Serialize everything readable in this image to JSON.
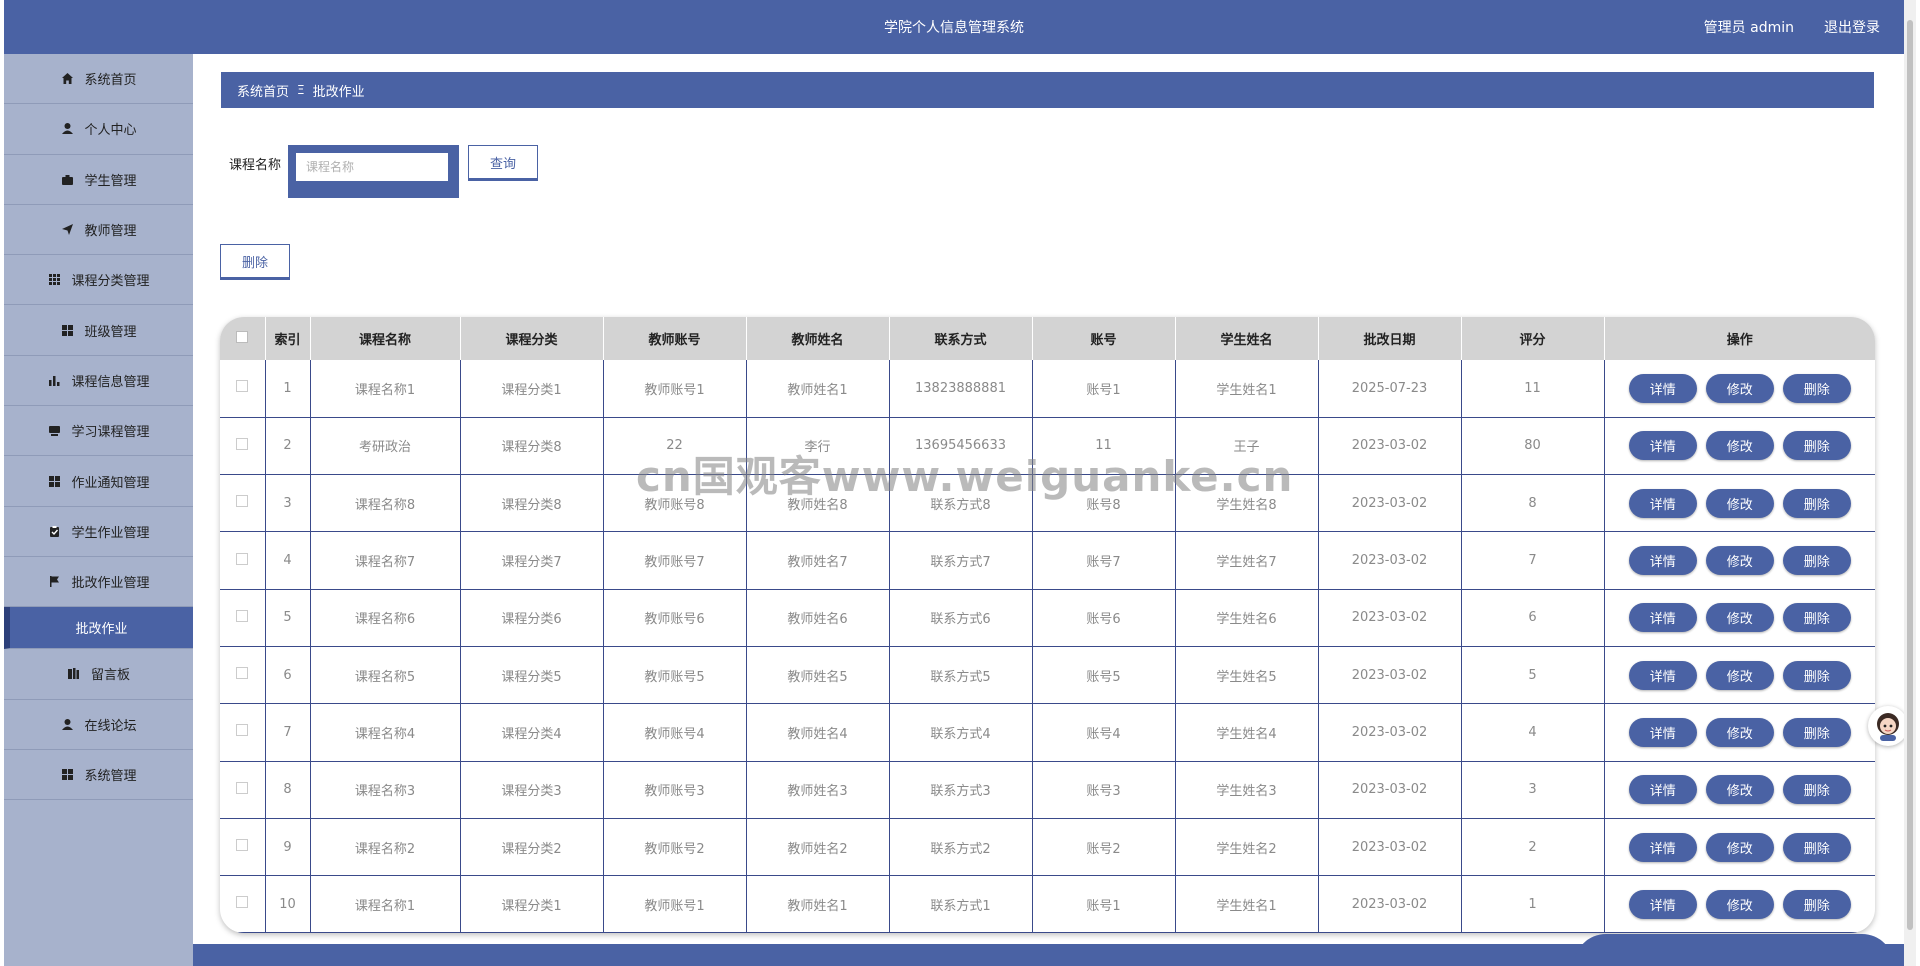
{
  "header": {
    "title": "学院个人信息管理系统",
    "admin": "管理员 admin",
    "logout": "退出登录"
  },
  "sidebar": {
    "items": [
      {
        "label": "系统首页",
        "icon": "home-icon"
      },
      {
        "label": "个人中心",
        "icon": "user-icon"
      },
      {
        "label": "学生管理",
        "icon": "briefcase-icon"
      },
      {
        "label": "教师管理",
        "icon": "paper-plane-icon"
      },
      {
        "label": "课程分类管理",
        "icon": "grid-icon"
      },
      {
        "label": "班级管理",
        "icon": "apps-icon"
      },
      {
        "label": "课程信息管理",
        "icon": "bar-chart-icon"
      },
      {
        "label": "学习课程管理",
        "icon": "monitor-icon"
      },
      {
        "label": "作业通知管理",
        "icon": "apps-icon"
      },
      {
        "label": "学生作业管理",
        "icon": "clipboard-icon"
      },
      {
        "label": "批改作业管理",
        "icon": "flag-icon"
      },
      {
        "label": "批改作业",
        "icon": ""
      },
      {
        "label": "留言板",
        "icon": "book-icon"
      },
      {
        "label": "在线论坛",
        "icon": "user-icon"
      },
      {
        "label": "系统管理",
        "icon": "apps-icon"
      }
    ]
  },
  "breadcrumb": {
    "home": "系统首页",
    "sep": "Ξ",
    "current": "批改作业"
  },
  "search": {
    "label": "课程名称",
    "placeholder": "课程名称",
    "button": "查询"
  },
  "actions": {
    "delete": "删除"
  },
  "table": {
    "headers": [
      "索引",
      "课程名称",
      "课程分类",
      "教师账号",
      "教师姓名",
      "联系方式",
      "账号",
      "学生姓名",
      "批改日期",
      "评分",
      "操作"
    ],
    "rows": [
      [
        "1",
        "课程名称1",
        "课程分类1",
        "教师账号1",
        "教师姓名1",
        "13823888881",
        "账号1",
        "学生姓名1",
        "2025-07-23",
        "11"
      ],
      [
        "2",
        "考研政治",
        "课程分类8",
        "22",
        "李行",
        "13695456633",
        "11",
        "王子",
        "2023-03-02",
        "80"
      ],
      [
        "3",
        "课程名称8",
        "课程分类8",
        "教师账号8",
        "教师姓名8",
        "联系方式8",
        "账号8",
        "学生姓名8",
        "2023-03-02",
        "8"
      ],
      [
        "4",
        "课程名称7",
        "课程分类7",
        "教师账号7",
        "教师姓名7",
        "联系方式7",
        "账号7",
        "学生姓名7",
        "2023-03-02",
        "7"
      ],
      [
        "5",
        "课程名称6",
        "课程分类6",
        "教师账号6",
        "教师姓名6",
        "联系方式6",
        "账号6",
        "学生姓名6",
        "2023-03-02",
        "6"
      ],
      [
        "6",
        "课程名称5",
        "课程分类5",
        "教师账号5",
        "教师姓名5",
        "联系方式5",
        "账号5",
        "学生姓名5",
        "2023-03-02",
        "5"
      ],
      [
        "7",
        "课程名称4",
        "课程分类4",
        "教师账号4",
        "教师姓名4",
        "联系方式4",
        "账号4",
        "学生姓名4",
        "2023-03-02",
        "4"
      ],
      [
        "8",
        "课程名称3",
        "课程分类3",
        "教师账号3",
        "教师姓名3",
        "联系方式3",
        "账号3",
        "学生姓名3",
        "2023-03-02",
        "3"
      ],
      [
        "9",
        "课程名称2",
        "课程分类2",
        "教师账号2",
        "教师姓名2",
        "联系方式2",
        "账号2",
        "学生姓名2",
        "2023-03-02",
        "2"
      ],
      [
        "10",
        "课程名称1",
        "课程分类1",
        "教师账号1",
        "教师姓名1",
        "联系方式1",
        "账号1",
        "学生姓名1",
        "2023-03-02",
        "1"
      ]
    ],
    "row_actions": [
      "详情",
      "修改",
      "删除"
    ]
  },
  "watermark": "cn国观客www.weiguanke.cn",
  "colors": {
    "primary": "#4a62a4",
    "sidebar": "#a7b2cc",
    "header_row": "#d3d3d3"
  }
}
